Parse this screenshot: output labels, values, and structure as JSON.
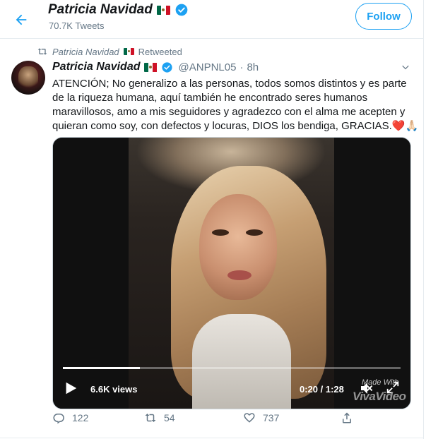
{
  "header": {
    "name": "Patricia Navidad",
    "tweet_count": "70.7K Tweets",
    "follow_label": "Follow"
  },
  "retweet_context": {
    "name": "Patricia Navidad",
    "label": "Retweeted"
  },
  "tweet": {
    "name": "Patricia Navidad",
    "handle": "@ANPNL05",
    "separator": "·",
    "time": "8h",
    "text": "ATENCIÓN; No generalizo a las personas, todos somos distintos y es parte de la riqueza humana, aquí también he encontrado seres humanos maravillosos, amo a mis seguidores y agradezco con el alma me acepten y quieran como soy, con defectos y locuras, DIOS los bendiga, GRACIAS.",
    "emoji_heart": "❤️",
    "emoji_hands": "🙏🏻"
  },
  "video": {
    "views": "6.6K views",
    "timecode": "0:20 / 1:28",
    "progress_fraction": 0.227,
    "watermark_line1": "Made With",
    "watermark_line2": "VivaVideo"
  },
  "actions": {
    "reply_count": "122",
    "retweet_count": "54",
    "like_count": "737"
  },
  "colors": {
    "accent": "#1da1f2",
    "secondary_text": "#657786",
    "heart": "#e0245e"
  },
  "icons": {
    "back": "arrow-left-icon",
    "verified": "verified-badge-icon",
    "flag": "mexico-flag-icon",
    "retweet": "retweet-icon",
    "caret": "chevron-down-icon",
    "play": "play-icon",
    "mute": "speaker-muted-icon",
    "expand": "expand-icon",
    "reply": "reply-icon",
    "like": "heart-icon",
    "share": "share-icon"
  }
}
